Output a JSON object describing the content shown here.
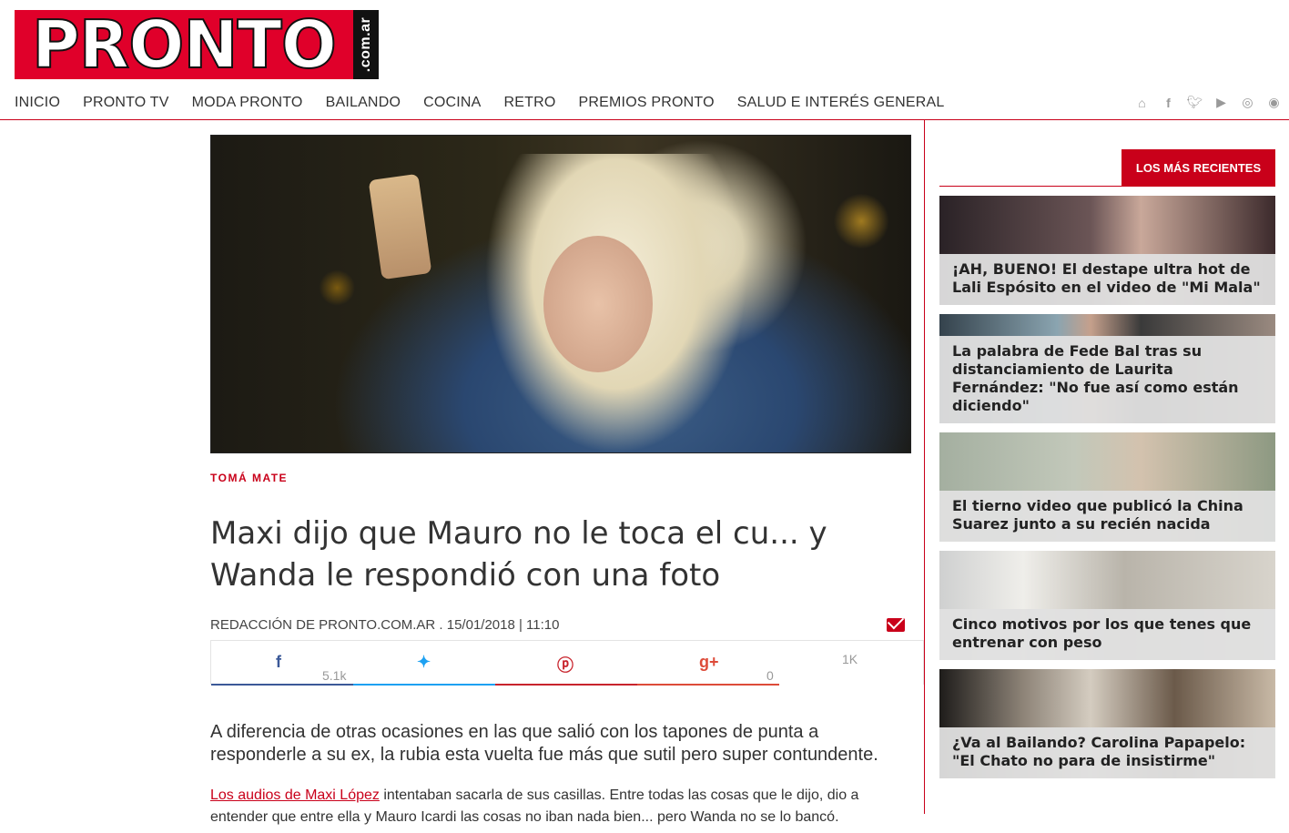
{
  "logo": {
    "main": "PRONTO",
    "side": ".com.ar"
  },
  "nav": [
    "INICIO",
    "PRONTO TV",
    "MODA PRONTO",
    "BAILANDO",
    "COCINA",
    "RETRO",
    "PREMIOS PRONTO",
    "SALUD E INTERÉS GENERAL"
  ],
  "social_icons": [
    "home-icon",
    "facebook-icon",
    "twitter-icon",
    "youtube-icon",
    "instagram-icon",
    "rss-icon"
  ],
  "article": {
    "section": "TOMÁ MATE",
    "title": "Maxi dijo que Mauro no le toca el cu... y Wanda le respondió con una foto",
    "byline": "REDACCIÓN DE PRONTO.COM.AR . 15/01/2018 | 11:10",
    "share": {
      "facebook_count": "5.1k",
      "googleplus_count": "0",
      "total": "1K"
    },
    "lead": "A diferencia de otras ocasiones en las que salió con los tapones de punta a responderle a su ex, la rubia esta vuelta fue más que sutil pero super contundente.",
    "para_link": "Los audios de Maxi López",
    "para_rest": " intentaban sacarla de sus casillas. Entre todas las cosas que le dijo, dio a entender que entre ella y Mauro Icardi las cosas no iban nada bien... pero Wanda no se lo bancó."
  },
  "sidebar": {
    "tab": "LOS MÁS RECIENTES",
    "items": [
      "¡AH, BUENO! El destape ultra hot de Lali Espósito en el video de \"Mi Mala\"",
      "La palabra de Fede Bal tras su distanciamiento de Laurita Fernández: \"No fue así como están diciendo\"",
      "El tierno video que publicó la China Suarez junto a su recién nacida",
      "Cinco motivos por los que tenes que entrenar con peso",
      "¿Va al Bailando? Carolina Papapelo: \"El Chato no para de insistirme\""
    ]
  },
  "colors": {
    "brand": "#c9001a",
    "facebook": "#3b5998",
    "twitter": "#1da1f2",
    "pinterest": "#c8232c",
    "googleplus": "#dd4b39"
  }
}
